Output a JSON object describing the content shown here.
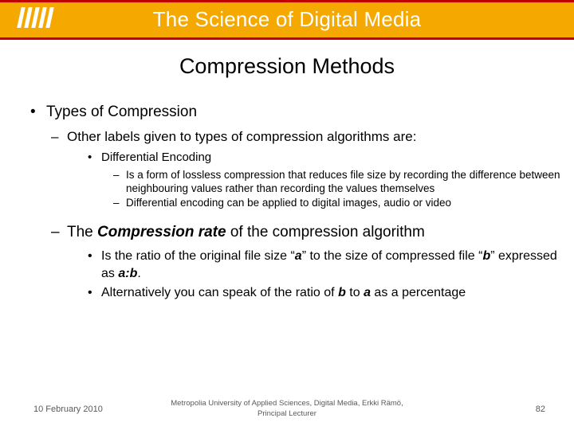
{
  "header": {
    "title": "The Science of Digital Media",
    "logo_name": "metropolia-logo",
    "band_color": "#F5A800",
    "band_border_color": "#C00000",
    "title_color": "#FFFFFF"
  },
  "slide": {
    "title": "Compression Methods",
    "bullets": {
      "b1": "Types of Compression",
      "b2": "Other labels given to types of compression algorithms are:",
      "b3": "Differential Encoding",
      "b4": "Is a form of lossless compression that reduces file size by recording the difference between neighbouring values rather than recording the values themselves",
      "b5": "Differential encoding can be applied to digital images, audio or video",
      "b6_pre": "The ",
      "b6_em": "Compression rate",
      "b6_post": " of the compression algorithm",
      "b7_pre": "Is the ratio of the original file size “",
      "b7_em1": "a",
      "b7_mid": "” to the size of compressed file “",
      "b7_em2": "b",
      "b7_mid2": "” expressed as ",
      "b7_em3": "a:b",
      "b7_post": ".",
      "b8_pre": "Alternatively you can speak of the ratio of ",
      "b8_em1": "b",
      "b8_mid": " to ",
      "b8_em2": "a",
      "b8_post": " as a percentage"
    },
    "markers": {
      "dot": "•",
      "dash": "–"
    }
  },
  "footer": {
    "date": "10 February 2010",
    "organisation": "Metropolia University of Applied Sciences,  Digital Media, Erkki Rämö, Principal Lecturer",
    "page": "82"
  }
}
